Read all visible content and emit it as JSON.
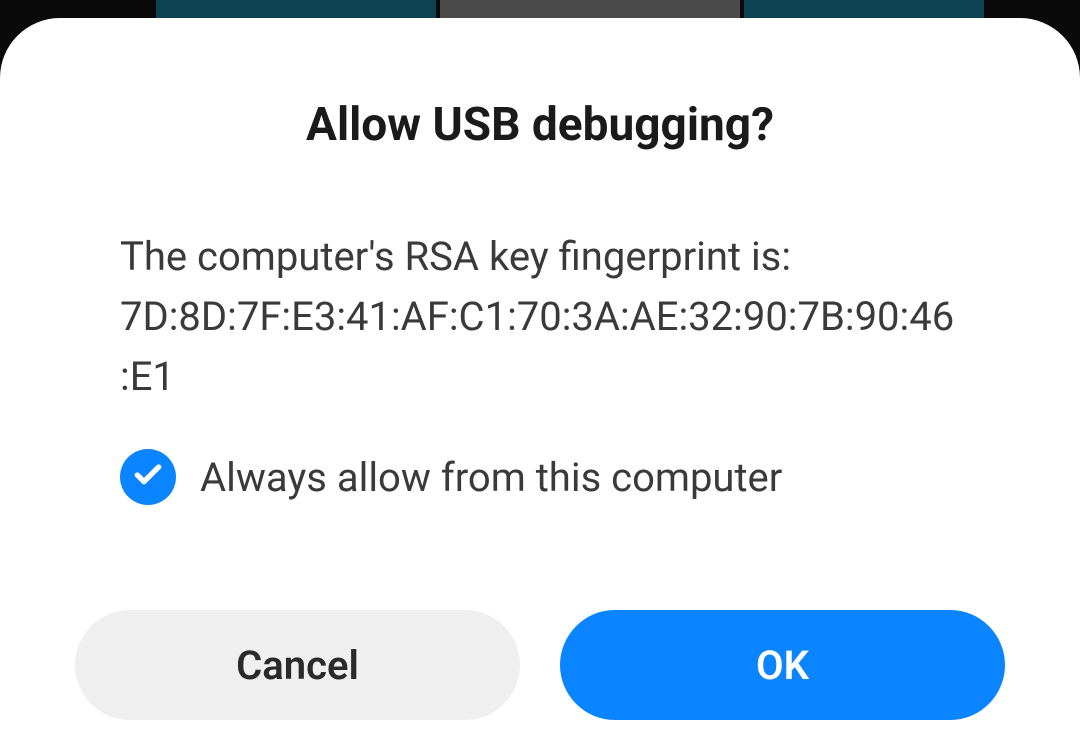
{
  "dialog": {
    "title": "Allow USB debugging?",
    "message": "The computer's RSA key fingerprint is:\n7D:8D:7F:E3:41:AF:C1:70:3A:AE:32:90:7B:90:46:E1",
    "checkbox": {
      "label": "Always allow from this computer",
      "checked": true
    },
    "buttons": {
      "cancel": "Cancel",
      "ok": "OK"
    }
  },
  "colors": {
    "accent": "#0a84ff",
    "cancel_bg": "#efefef"
  }
}
